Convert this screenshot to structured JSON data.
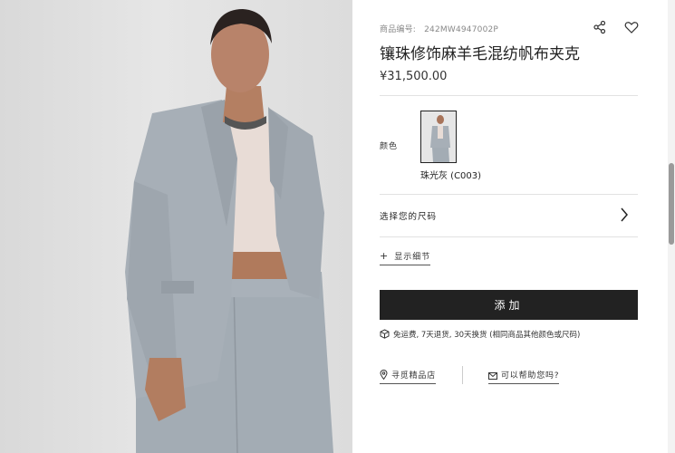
{
  "product": {
    "sku_label": "商品编号:",
    "sku_value": "242MW4947002P",
    "title": "镶珠修饰麻羊毛混纺帆布夹克",
    "price": "¥31,500.00"
  },
  "color": {
    "label": "颜色",
    "selected_name": "珠光灰 (C003)"
  },
  "size": {
    "label": "选择您的尺码"
  },
  "details": {
    "label": "显示细节"
  },
  "cart": {
    "add_label": "添加"
  },
  "policy": {
    "text": "免运费, 7天退货, 30天换货 (相同商品其他颜色或尺码)"
  },
  "links": {
    "store": "寻觅精品店",
    "help": "可以帮助您吗?"
  },
  "icons": {
    "share": "share-icon",
    "wishlist": "heart-icon",
    "chevron": "chevron-right-icon",
    "box": "box-icon",
    "location": "location-pin-icon",
    "mail": "mail-icon"
  },
  "colors": {
    "button_bg": "#222222",
    "photo_bg": "#dedede",
    "suit_grey": "#a7afb7"
  }
}
